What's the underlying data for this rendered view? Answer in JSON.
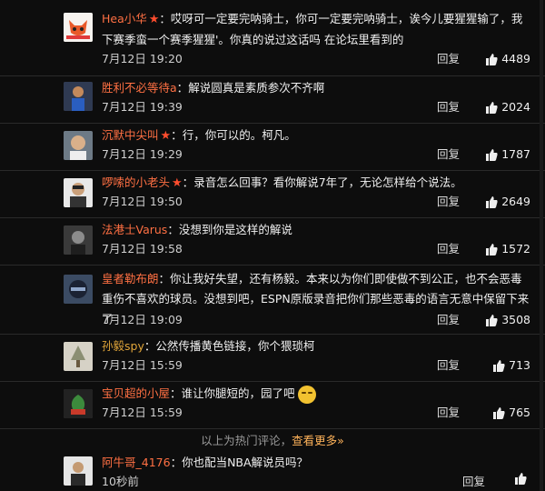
{
  "comments": [
    {
      "name": "Hea小华",
      "star": true,
      "text": "哎呀可一定要完呐骑士，你可一定要完呐骑士，诶今儿要猩猩输了，我下赛季蛮一个赛季猩猩'。你真的说过这话吗 在论坛里看到的",
      "time": "7月12日 19:20",
      "reply": "回复",
      "likes": "4489",
      "avatar_icon": "fox-avatar"
    },
    {
      "name": "胜利不必等待a",
      "star": false,
      "text": "解说圆真是素质参次不齐啊",
      "time": "7月12日 19:39",
      "reply": "回复",
      "likes": "2024",
      "avatar_icon": "player-avatar"
    },
    {
      "name": "沉默中尖叫",
      "star": true,
      "text": "行，你可以的。柯凡。",
      "time": "7月12日 19:29",
      "reply": "回复",
      "likes": "1787",
      "avatar_icon": "face-avatar"
    },
    {
      "name": "啰嗦的小老头",
      "star": true,
      "text": "录音怎么回事？看你解说7年了，无论怎样给个说法。",
      "time": "7月12日 19:50",
      "reply": "回复",
      "likes": "2649",
      "avatar_icon": "man-avatar"
    },
    {
      "name": "法港士Varus",
      "star": false,
      "text": "没想到你是这样的解说",
      "time": "7月12日 19:58",
      "reply": "回复",
      "likes": "1572",
      "avatar_icon": "dark-avatar"
    },
    {
      "name": "皇者勒布朗",
      "star": false,
      "text": "你让我好失望，还有杨毅。本来以为你们即使做不到公正，也不会恶毒重伤不喜欢的球员。没想到吧，ESPN原版录音把你们那些恶毒的语言无意中保留下来了",
      "time": "7月12日 19:09",
      "reply": "回复",
      "likes": "3508",
      "avatar_icon": "helmet-avatar"
    },
    {
      "name": "孙毅spy",
      "star": false,
      "text": "公然传播黄色链接，你个猥琐柯",
      "time": "7月12日 15:59",
      "reply": "回复",
      "likes": "713",
      "avatar_icon": "tree-avatar",
      "gold": true
    },
    {
      "name": "宝贝超的小屋",
      "star": false,
      "text": "谁让你腿短的，园了吧",
      "time": "7月12日 15:59",
      "reply": "回复",
      "likes": "765",
      "avatar_icon": "plant-avatar",
      "emoji": true
    },
    {
      "name": "阿牛哥_4176",
      "star": false,
      "text": "你也配当NBA解说员吗？",
      "time": "10秒前",
      "reply": "回复",
      "likes": "",
      "avatar_icon": "person-avatar"
    }
  ],
  "more_bar": {
    "prefix": "以上为热门评论，",
    "link": "查看更多»"
  },
  "colors": {
    "name": "#ff7043",
    "link": "#ffb35a",
    "star": "#ff4d2e"
  }
}
